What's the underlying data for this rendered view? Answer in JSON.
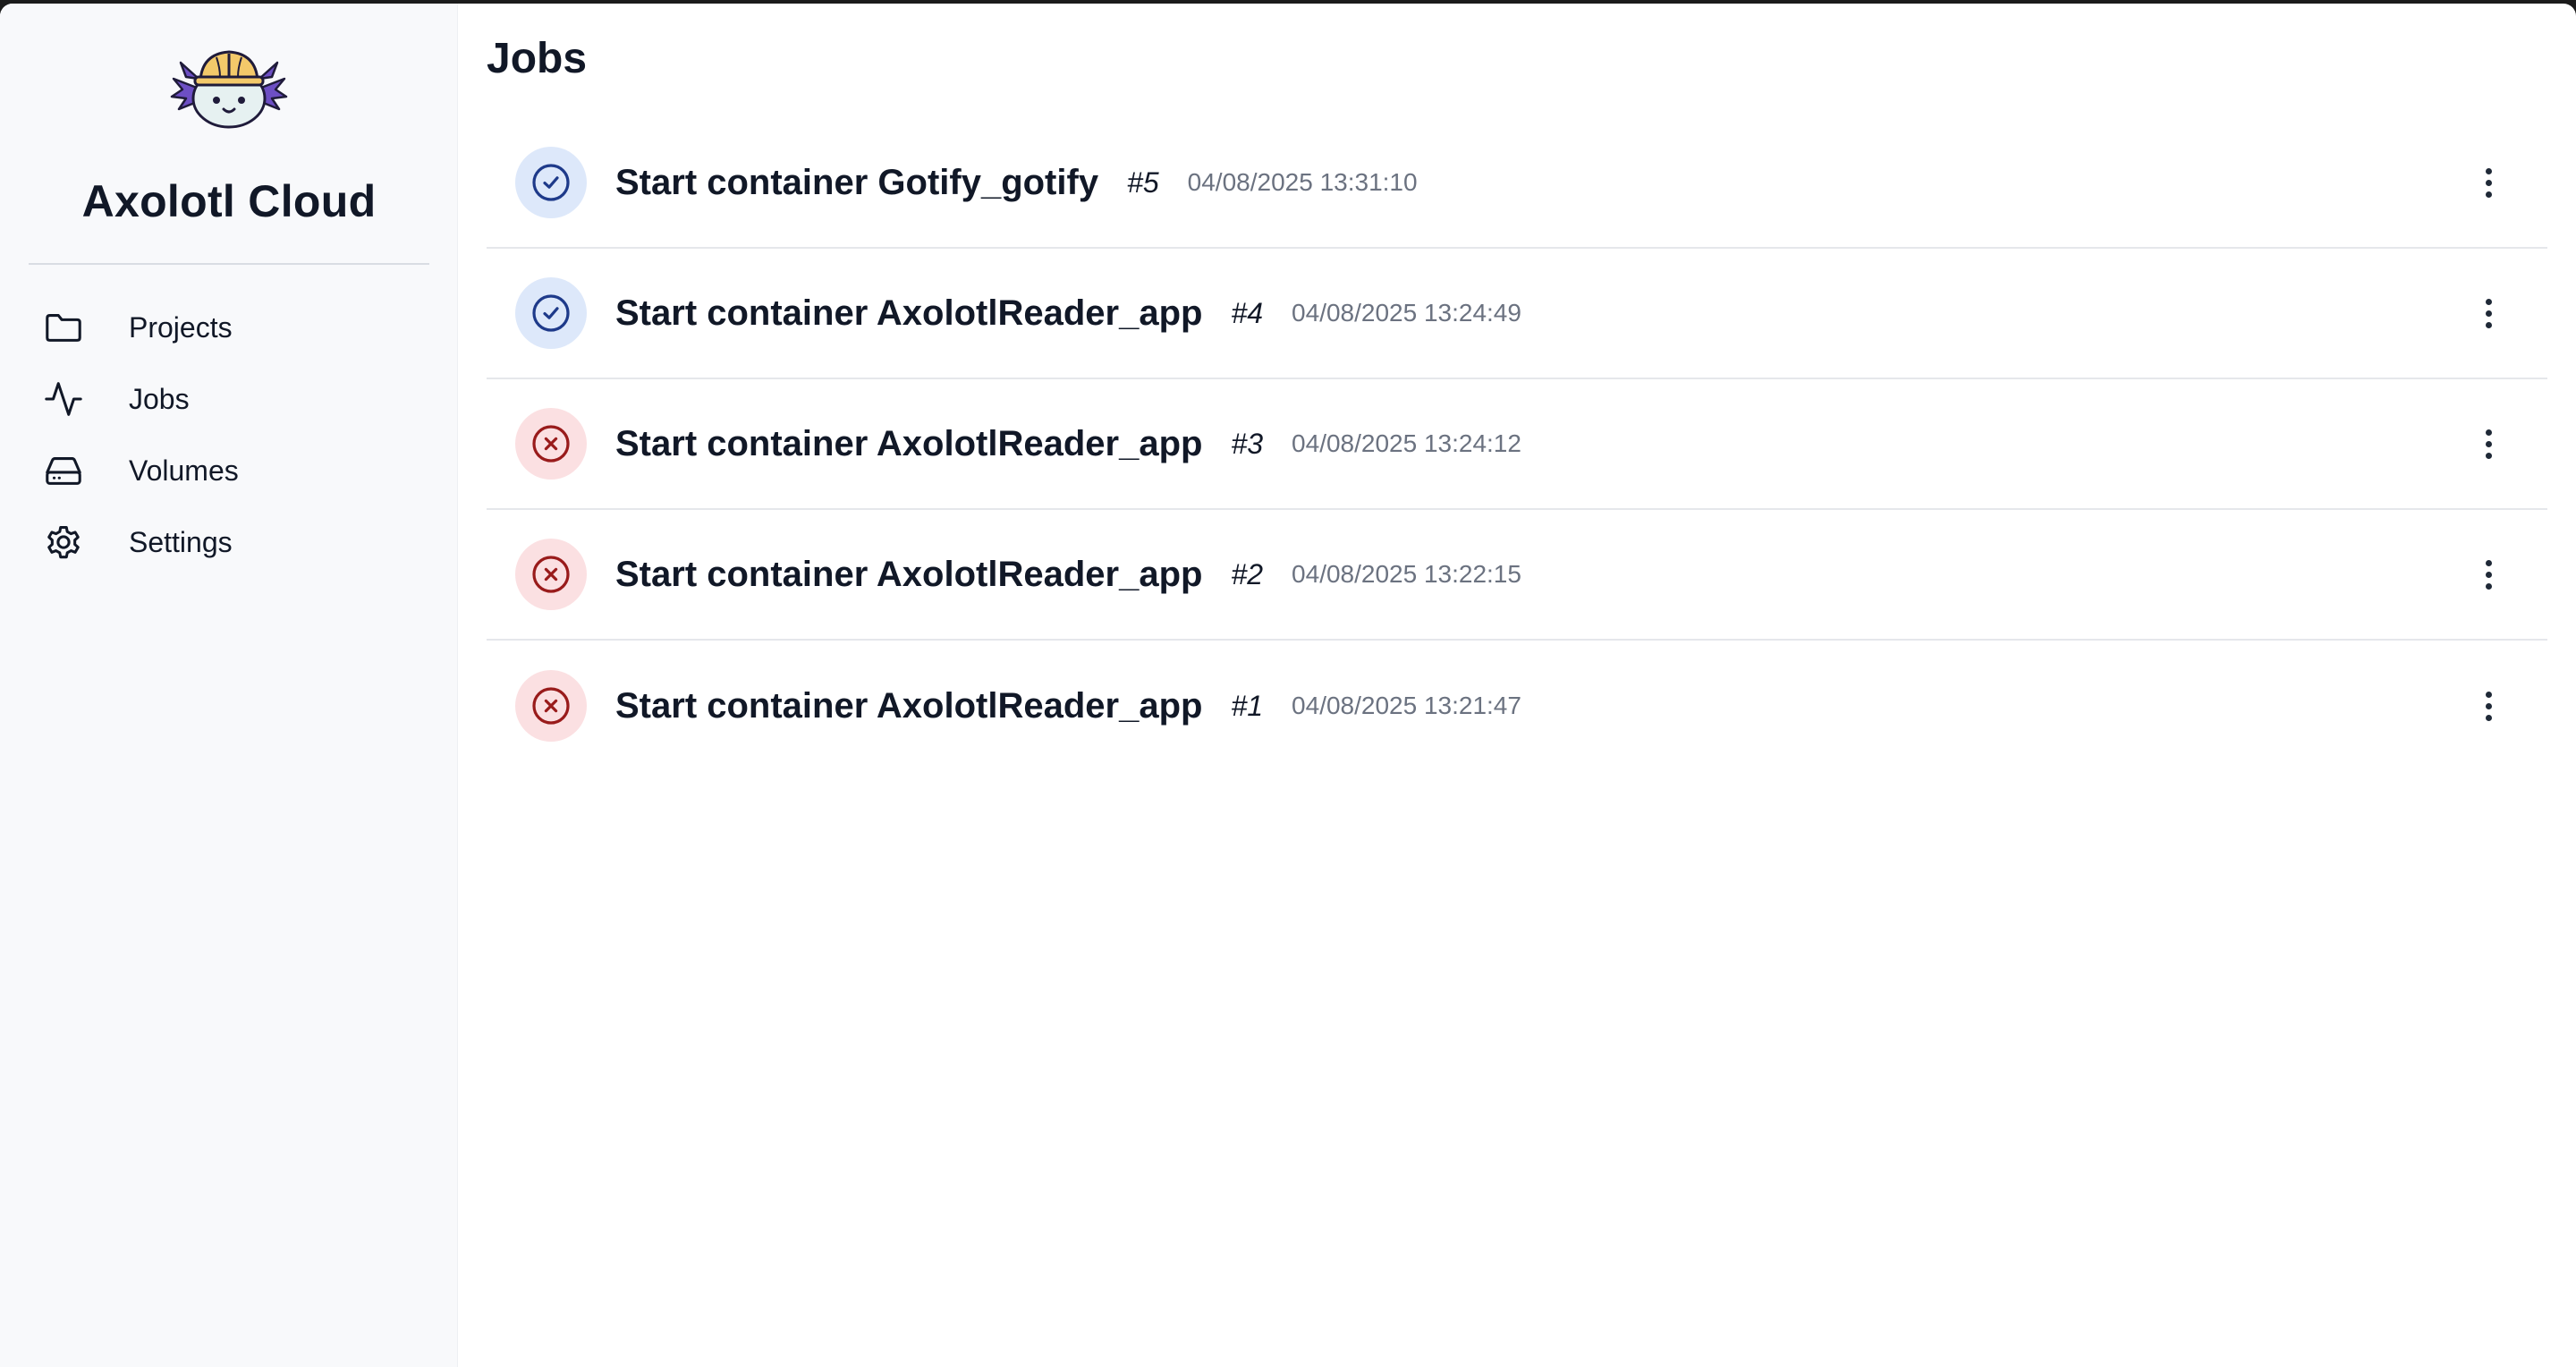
{
  "app": {
    "brand": "Axolotl Cloud"
  },
  "sidebar": {
    "items": [
      {
        "label": "Projects",
        "icon": "folder-icon"
      },
      {
        "label": "Jobs",
        "icon": "activity-icon"
      },
      {
        "label": "Volumes",
        "icon": "hard-drive-icon"
      },
      {
        "label": "Settings",
        "icon": "gear-icon"
      }
    ]
  },
  "main": {
    "title": "Jobs"
  },
  "jobs": [
    {
      "title": "Start container Gotify_gotify",
      "number": "#5",
      "date": "04/08/2025 13:31:10",
      "status": "success"
    },
    {
      "title": "Start container AxolotlReader_app",
      "number": "#4",
      "date": "04/08/2025 13:24:49",
      "status": "success"
    },
    {
      "title": "Start container AxolotlReader_app",
      "number": "#3",
      "date": "04/08/2025 13:24:12",
      "status": "failed"
    },
    {
      "title": "Start container AxolotlReader_app",
      "number": "#2",
      "date": "04/08/2025 13:22:15",
      "status": "failed"
    },
    {
      "title": "Start container AxolotlReader_app",
      "number": "#1",
      "date": "04/08/2025 13:21:47",
      "status": "failed"
    }
  ],
  "colors": {
    "success_bg": "#dde8fa",
    "success_icon": "#1e3a8a",
    "failed_bg": "#fbe0e2",
    "failed_icon": "#991b1b",
    "sidebar_bg": "#f8f9fb"
  }
}
